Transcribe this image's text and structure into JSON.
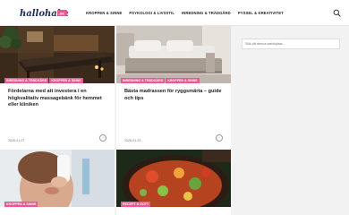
{
  "site": {
    "logo_text": "hallohalsa.se",
    "brand_color": "#e8598f"
  },
  "nav": {
    "items": [
      {
        "label": "KROPPEN & SINNE"
      },
      {
        "label": "PSYKOLOGI & LIVSSTIL"
      },
      {
        "label": "INREDNING & TRÄDGÅRD"
      },
      {
        "label": "PYSSEL & KREATIVITET"
      }
    ],
    "search_icon": "search-icon"
  },
  "cards": [
    {
      "tags": [
        "INREDNING & TRÄDGÅRD",
        "KROPPEN & SINNE"
      ],
      "title": "Fördelarna med att investera i en högkvalitativ massagebänk för hemmet eller kliniken",
      "date": "2026-01-07"
    },
    {
      "tags": [
        "INREDNING & TRÄDGÅRD",
        "KROPPEN & SINNE"
      ],
      "title": "Bästa madrassen för ryggsmärta – guide och tips",
      "date": "2026-01-03"
    },
    {
      "tags": [
        "KROPPEN & SINNE"
      ],
      "title": "",
      "date": ""
    },
    {
      "tags": [
        "RECEPT & GOTT"
      ],
      "title": "",
      "date": ""
    }
  ],
  "sidebar": {
    "search_placeholder": "Sök på denna webbplats..."
  }
}
